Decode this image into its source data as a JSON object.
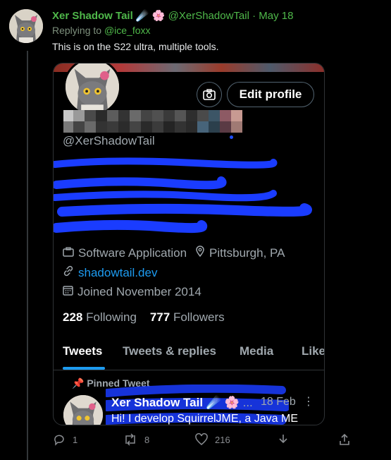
{
  "tweet": {
    "author_name": "Xer Shadow Tail",
    "author_emojis": "☄️ 🌸",
    "handle": "@XerShadowTail",
    "separator": "·",
    "date": "May 18",
    "replying_prefix": "Replying to",
    "replying_to": "@ice_foxx",
    "text": "This is on the S22 ultra, multiple tools."
  },
  "profile": {
    "edit_profile_label": "Edit profile",
    "handle": "@XerShadowTail",
    "category": "Software Application",
    "location": "Pittsburgh, PA",
    "website": "shadowtail.dev",
    "joined": "Joined November 2014",
    "following_count": "228",
    "following_label": "Following",
    "followers_count": "777",
    "followers_label": "Followers",
    "tabs": [
      "Tweets",
      "Tweets & replies",
      "Media",
      "Like"
    ]
  },
  "pinned": {
    "label": "Pinned Tweet",
    "name": "Xer Shadow Tail",
    "emojis": "☄️ 🌸",
    "ellipsis": "...",
    "date": "18 Feb",
    "text": "Hi! I develop SquirrelJME, a Java ME"
  },
  "actions": {
    "replies": "1",
    "retweets": "8",
    "likes": "216"
  },
  "colors": {
    "accent_green": "#4fb84a",
    "link_blue": "#1d9bf0",
    "scribble_blue": "#1a3cff"
  }
}
